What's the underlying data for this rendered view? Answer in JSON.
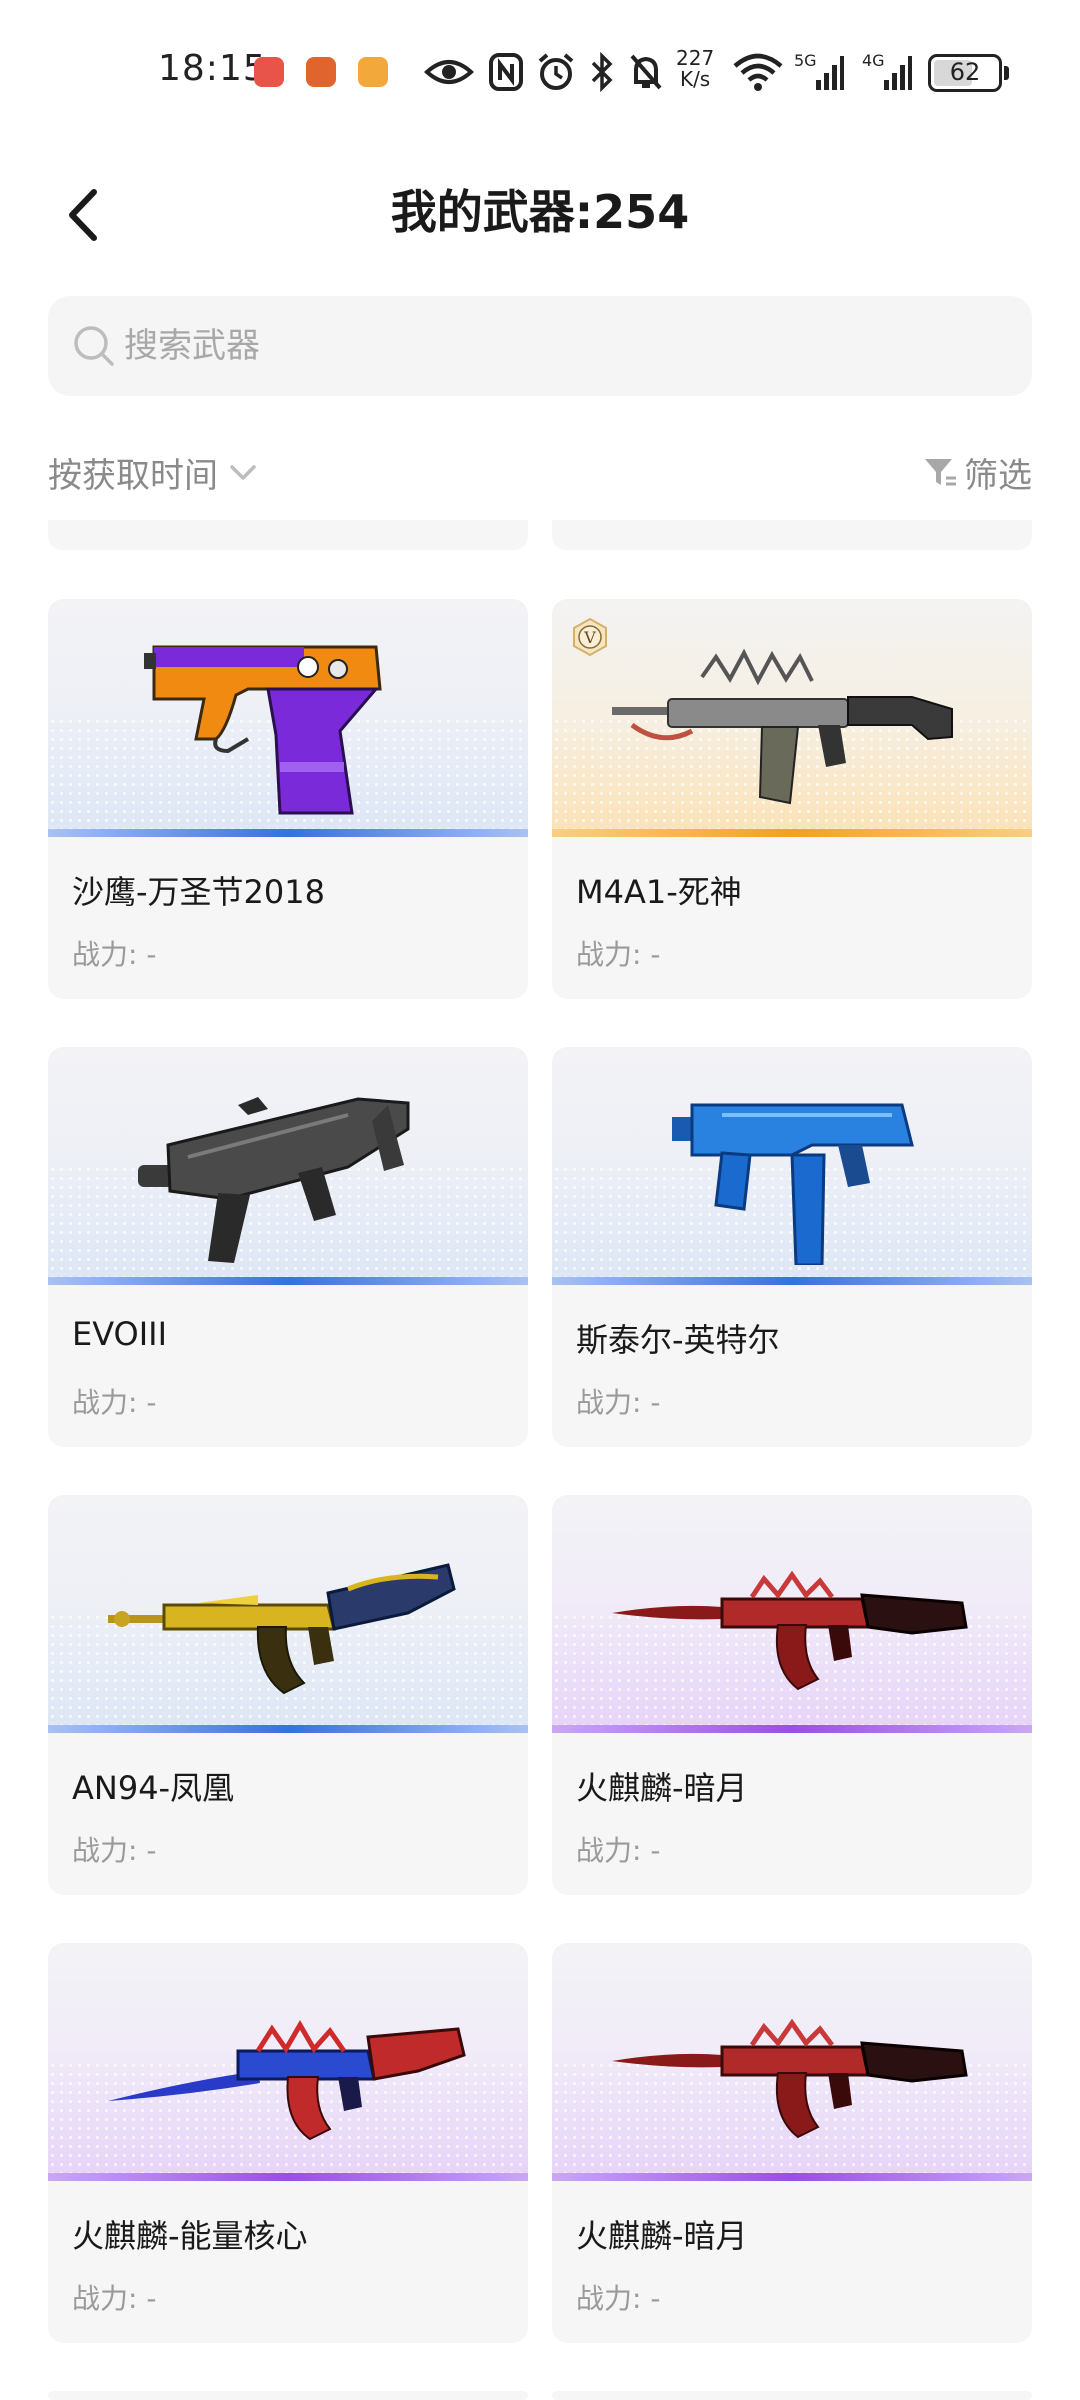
{
  "status_bar": {
    "time": "18:15",
    "net_speed_value": "227",
    "net_speed_unit": "K/s",
    "signal_1": "5G",
    "signal_2": "4G",
    "battery": "62",
    "battery_level": 0.62,
    "icons": [
      "app-icon-1",
      "app-icon-2",
      "app-icon-3",
      "eye-icon",
      "nfc-icon",
      "alarm-icon",
      "bluetooth-icon",
      "mute-icon",
      "wifi-icon",
      "signal-5g-icon",
      "signal-4g-icon",
      "battery-icon"
    ]
  },
  "header": {
    "title": "我的武器:254",
    "back_icon": "chevron-left-icon"
  },
  "search": {
    "placeholder": "搜索武器",
    "value": "",
    "icon": "search-icon"
  },
  "toolbar": {
    "sort_label": "按获取时间",
    "filter_label": "筛选"
  },
  "colors": {
    "rarity_blue": "#3a6fe0",
    "rarity_gold": "#f2a21c",
    "rarity_purple": "#9a4de8",
    "card_bg": "#f6f6f6",
    "muted_text": "#8a8a8a"
  },
  "weapons": [
    {
      "name": "沙鹰-万圣节2018",
      "power": "战力: -",
      "rarity": "blue"
    },
    {
      "name": "M4A1-死神",
      "power": "战力: -",
      "rarity": "gold",
      "badge": "V"
    },
    {
      "name": "EVOIII",
      "power": "战力: -",
      "rarity": "blue"
    },
    {
      "name": "斯泰尔-英特尔",
      "power": "战力: -",
      "rarity": "blue"
    },
    {
      "name": "AN94-凤凰",
      "power": "战力: -",
      "rarity": "blue"
    },
    {
      "name": "火麒麟-暗月",
      "power": "战力: -",
      "rarity": "purple"
    },
    {
      "name": "火麒麟-能量核心",
      "power": "战力: -",
      "rarity": "purple"
    },
    {
      "name": "火麒麟-暗月",
      "power": "战力: -",
      "rarity": "purple"
    }
  ]
}
